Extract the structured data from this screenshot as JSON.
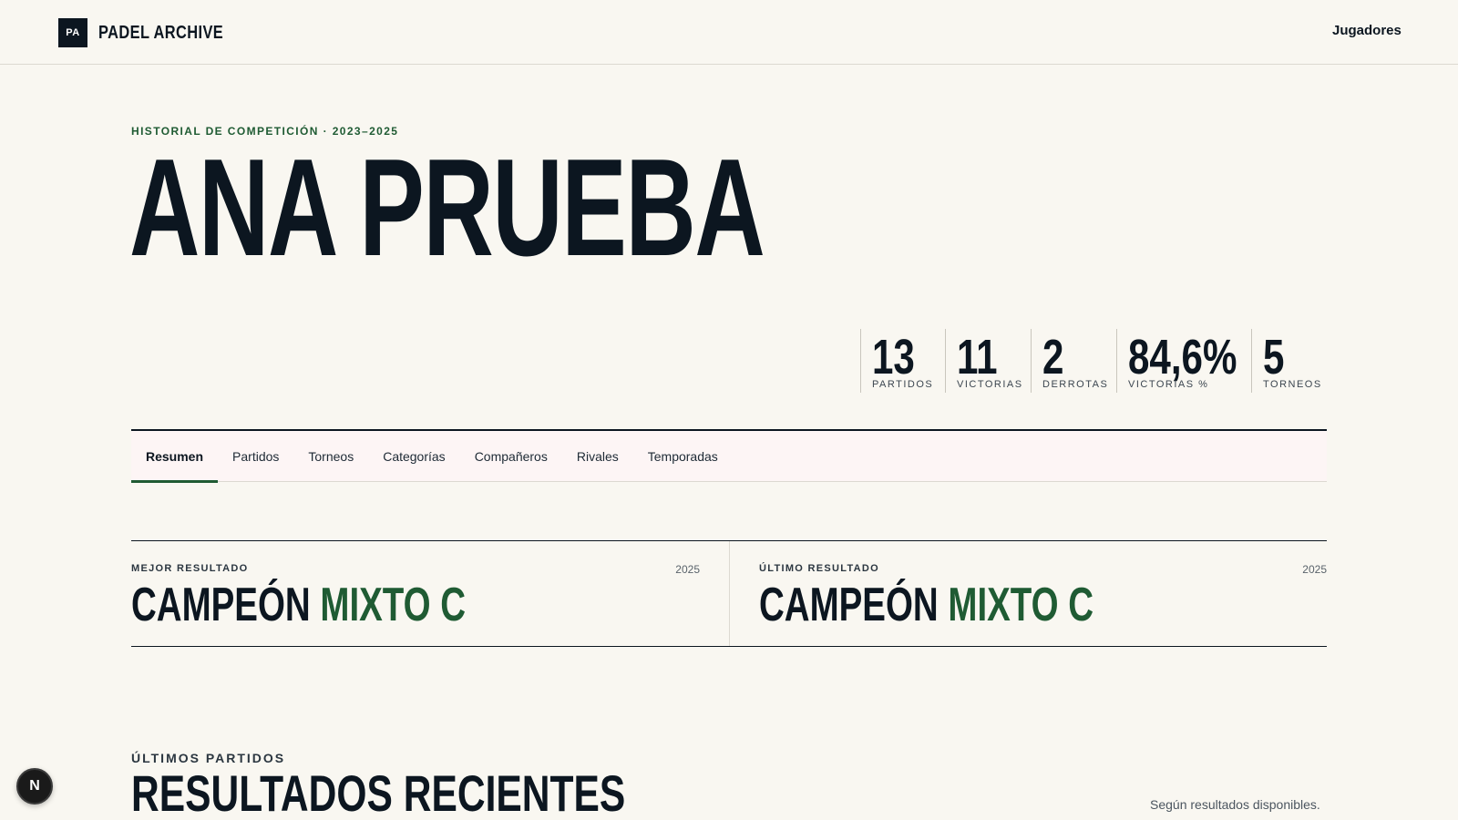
{
  "header": {
    "logo_text": "PA",
    "brand": "PADEL ARCHIVE",
    "nav_link": "Jugadores"
  },
  "hero": {
    "eyebrow": "HISTORIAL DE COMPETICIÓN · 2023–2025",
    "name": "ANA PRUEBA"
  },
  "stats": [
    {
      "value": "13",
      "label": "PARTIDOS"
    },
    {
      "value": "11",
      "label": "VICTORIAS"
    },
    {
      "value": "2",
      "label": "DERROTAS"
    },
    {
      "value": "84,6%",
      "label": "VICTORIAS %"
    },
    {
      "value": "5",
      "label": "TORNEOS"
    }
  ],
  "tabs": [
    {
      "label": "Resumen",
      "active": true
    },
    {
      "label": "Partidos"
    },
    {
      "label": "Torneos"
    },
    {
      "label": "Categorías"
    },
    {
      "label": "Compañeros"
    },
    {
      "label": "Rivales"
    },
    {
      "label": "Temporadas"
    }
  ],
  "results": {
    "best": {
      "label": "MEJOR RESULTADO",
      "year": "2025",
      "title": "CAMPEÓN",
      "category": "MIXTO C"
    },
    "latest": {
      "label": "ÚLTIMO RESULTADO",
      "year": "2025",
      "title": "CAMPEÓN",
      "category": "MIXTO C"
    }
  },
  "recent": {
    "kicker": "ÚLTIMOS PARTIDOS",
    "title": "RESULTADOS RECIENTES",
    "note": "Según resultados disponibles."
  },
  "fab": {
    "label": "N",
    "icon": "nextjs-badge-icon"
  },
  "colors": {
    "background": "#f9f7f1",
    "ink": "#0c1620",
    "accent": "#1f5b33",
    "tabs_bg": "#fdf5f5"
  }
}
